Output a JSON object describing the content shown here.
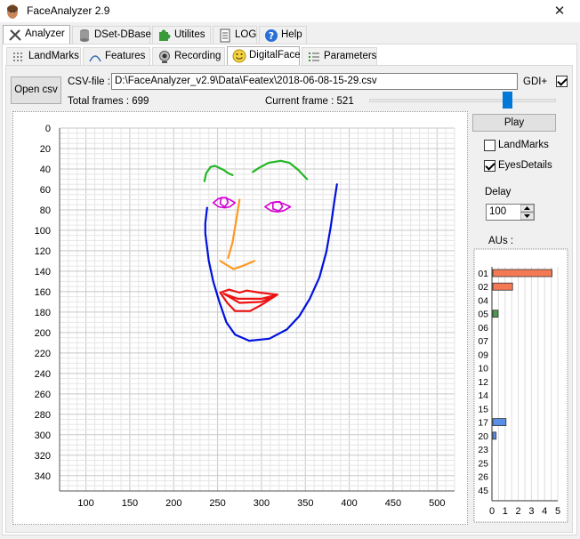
{
  "window": {
    "title": "FaceAnalyzer 2.9",
    "close_glyph": "✕"
  },
  "main_tabs": [
    {
      "label": "Analyzer",
      "icon": "tools-icon"
    },
    {
      "label": "DSet-DBase",
      "icon": "database-icon"
    },
    {
      "label": "Utilites",
      "icon": "puzzle-icon"
    },
    {
      "label": "LOG",
      "icon": "document-icon"
    },
    {
      "label": "Help",
      "icon": "help-icon"
    }
  ],
  "sub_tabs": [
    {
      "label": "LandMarks",
      "icon": "dots-grid-icon"
    },
    {
      "label": "Features",
      "icon": "features-icon"
    },
    {
      "label": "Recording",
      "icon": "webcam-icon"
    },
    {
      "label": "DigitalFace",
      "icon": "smiley-icon"
    },
    {
      "label": "Parameters",
      "icon": "list-icon"
    }
  ],
  "toolbar": {
    "open_csv": "Open csv",
    "csv_file_label": "CSV-file :",
    "csv_file_value": "D:\\FaceAnalyzer_v2.9\\Data\\Featex\\2018-06-08-15-29.csv",
    "gdi_label": "GDI+",
    "gdi_checked": true,
    "total_frames": "Total frames : 699",
    "current_frame": "Current frame : 521",
    "frame_position_fraction": 0.74
  },
  "controls": {
    "play": "Play",
    "landmarks_label": "LandMarks",
    "landmarks_checked": false,
    "eyesdetails_label": "EyesDetails",
    "eyesdetails_checked": true,
    "delay_label": "Delay",
    "delay_value": "100",
    "aus_label": "AUs :"
  },
  "colors": {
    "eyebrows": "#22b722",
    "eyes": "#d400d4",
    "nose": "#ff9922",
    "mouth": "#ee1111",
    "jaw": "#0011dd"
  },
  "chart_data": [
    {
      "type": "line",
      "title": "",
      "x_ticks": [
        100,
        150,
        200,
        250,
        300,
        350,
        400,
        450,
        500
      ],
      "y_ticks": [
        0,
        20,
        40,
        60,
        80,
        100,
        120,
        140,
        160,
        180,
        200,
        220,
        240,
        260,
        280,
        300,
        320,
        340
      ],
      "xlim": [
        70,
        520
      ],
      "ylim": [
        0,
        355
      ],
      "y_inverted": true,
      "grid": true,
      "series": [
        {
          "part": "eyebrows",
          "points": [
            [
              235,
              52
            ],
            [
              237,
              44
            ],
            [
              242,
              38
            ],
            [
              247,
              37
            ],
            [
              252,
              39
            ],
            [
              257,
              41
            ],
            [
              262,
              44
            ],
            [
              267,
              46
            ]
          ]
        },
        {
          "part": "eyebrows",
          "points": [
            [
              290,
              43
            ],
            [
              297,
              39
            ],
            [
              308,
              34
            ],
            [
              322,
              32
            ],
            [
              332,
              34
            ],
            [
              342,
              41
            ],
            [
              352,
              50
            ]
          ]
        },
        {
          "part": "eyes",
          "points": [
            [
              245,
              73
            ],
            [
              251,
              69
            ],
            [
              258,
              68
            ],
            [
              264,
              70
            ],
            [
              270,
              73
            ],
            [
              264,
              77
            ],
            [
              258,
              78
            ],
            [
              251,
              77
            ],
            [
              245,
              73
            ]
          ]
        },
        {
          "part": "eyes",
          "points": [
            [
              254,
              68
            ],
            [
              260,
              68
            ],
            [
              262,
              73
            ],
            [
              258,
              77
            ],
            [
              253,
              74
            ],
            [
              254,
              68
            ]
          ]
        },
        {
          "part": "eyes",
          "points": [
            [
              304,
              77
            ],
            [
              311,
              73
            ],
            [
              318,
              72
            ],
            [
              325,
              74
            ],
            [
              333,
              77
            ],
            [
              325,
              81
            ],
            [
              318,
              82
            ],
            [
              311,
              81
            ],
            [
              304,
              77
            ]
          ]
        },
        {
          "part": "eyes",
          "points": [
            [
              313,
              73
            ],
            [
              321,
              72
            ],
            [
              324,
              77
            ],
            [
              320,
              81
            ],
            [
              313,
              79
            ],
            [
              313,
              73
            ]
          ]
        },
        {
          "part": "nose",
          "points": [
            [
              275,
              70
            ],
            [
              267,
              112
            ],
            [
              262,
              127
            ]
          ]
        },
        {
          "part": "nose",
          "points": [
            [
              253,
              130
            ],
            [
              268,
              138
            ],
            [
              278,
              135
            ],
            [
              292,
              130
            ]
          ]
        },
        {
          "part": "mouth",
          "points": [
            [
              253,
              161
            ],
            [
              263,
              158
            ],
            [
              275,
              161
            ],
            [
              283,
              159
            ],
            [
              298,
              161
            ],
            [
              318,
              163
            ],
            [
              300,
              173
            ],
            [
              287,
              179
            ],
            [
              270,
              179
            ],
            [
              261,
              171
            ],
            [
              253,
              161
            ]
          ]
        },
        {
          "part": "mouth",
          "points": [
            [
              257,
              162
            ],
            [
              273,
              167
            ],
            [
              300,
              167
            ],
            [
              318,
              163
            ],
            [
              300,
              170
            ],
            [
              275,
              171
            ],
            [
              257,
              162
            ]
          ]
        },
        {
          "part": "jaw",
          "points": [
            [
              238,
              78
            ],
            [
              236,
              93
            ],
            [
              236,
              103
            ],
            [
              240,
              130
            ],
            [
              245,
              150
            ],
            [
              252,
              170
            ],
            [
              260,
              190
            ],
            [
              270,
              202
            ],
            [
              286,
              208
            ],
            [
              309,
              206
            ],
            [
              329,
              197
            ],
            [
              343,
              184
            ],
            [
              355,
              167
            ],
            [
              366,
              146
            ],
            [
              374,
              121
            ],
            [
              379,
              96
            ],
            [
              383,
              72
            ],
            [
              386,
              55
            ]
          ]
        }
      ]
    },
    {
      "type": "bar",
      "title": "",
      "orientation": "horizontal",
      "categories": [
        "01",
        "02",
        "04",
        "05",
        "06",
        "07",
        "09",
        "10",
        "12",
        "14",
        "15",
        "17",
        "20",
        "23",
        "25",
        "26",
        "45"
      ],
      "values": [
        4.5,
        1.5,
        0,
        0.4,
        0,
        0,
        0,
        0,
        0,
        0,
        0,
        1.0,
        0.25,
        0,
        0,
        0,
        0
      ],
      "bar_colors": [
        "#f47a55",
        "#f47a55",
        "#f47a55",
        "#4c9a4c",
        "#4c9a4c",
        "#4c9a4c",
        "#4c9a4c",
        "#4c9a4c",
        "#4c9a4c",
        "#4c9a4c",
        "#4c9a4c",
        "#5b8ee6",
        "#5b8ee6",
        "#5b8ee6",
        "#5b8ee6",
        "#5b8ee6",
        "#5b8ee6"
      ],
      "x_ticks": [
        0,
        1,
        2,
        3,
        4,
        5
      ],
      "xlim": [
        0,
        5
      ],
      "grid": true
    }
  ]
}
